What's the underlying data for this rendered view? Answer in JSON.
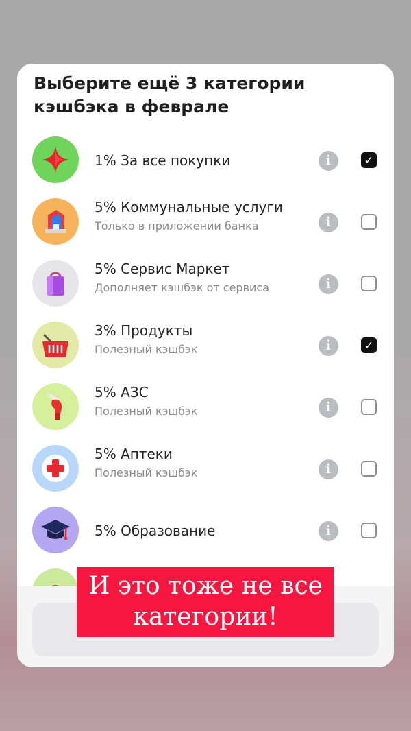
{
  "modal": {
    "title": "Выберите ещё 3 категории кэшбэка в феврале"
  },
  "categories": [
    {
      "title": "1% За все покупки",
      "subtitle": "",
      "checked": true,
      "icon": "star-icon",
      "icon_bg": "#6fd45a"
    },
    {
      "title": "5% Коммунальные услуги",
      "subtitle": "Только в приложении банка",
      "checked": false,
      "icon": "house-icon",
      "icon_bg": "#f7b35b"
    },
    {
      "title": "5% Сервис Маркет",
      "subtitle": "Дополняет кэшбэк от сервиса",
      "checked": false,
      "icon": "shopping-bag-icon",
      "icon_bg": "#e6e6e8"
    },
    {
      "title": "3% Продукты",
      "subtitle": "Полезный кэшбэк",
      "checked": true,
      "icon": "basket-icon",
      "icon_bg": "#e3e9a6"
    },
    {
      "title": "5% АЗС",
      "subtitle": "Полезный кэшбэк",
      "checked": false,
      "icon": "fuel-nozzle-icon",
      "icon_bg": "#d6ef9a"
    },
    {
      "title": "5% Аптеки",
      "subtitle": "Полезный кэшбэк",
      "checked": false,
      "icon": "pharmacy-cross-icon",
      "icon_bg": "#b9d6fb"
    },
    {
      "title": "5% Образование",
      "subtitle": "",
      "checked": false,
      "icon": "graduation-cap-icon",
      "icon_bg": "#b4a7f2"
    }
  ],
  "overlay_caption": {
    "line1": "И это тоже не все",
    "line2": "категории!"
  },
  "colors": {
    "banner": "#f5173f",
    "check_on": "#111111",
    "info": "#b9bcc1"
  }
}
